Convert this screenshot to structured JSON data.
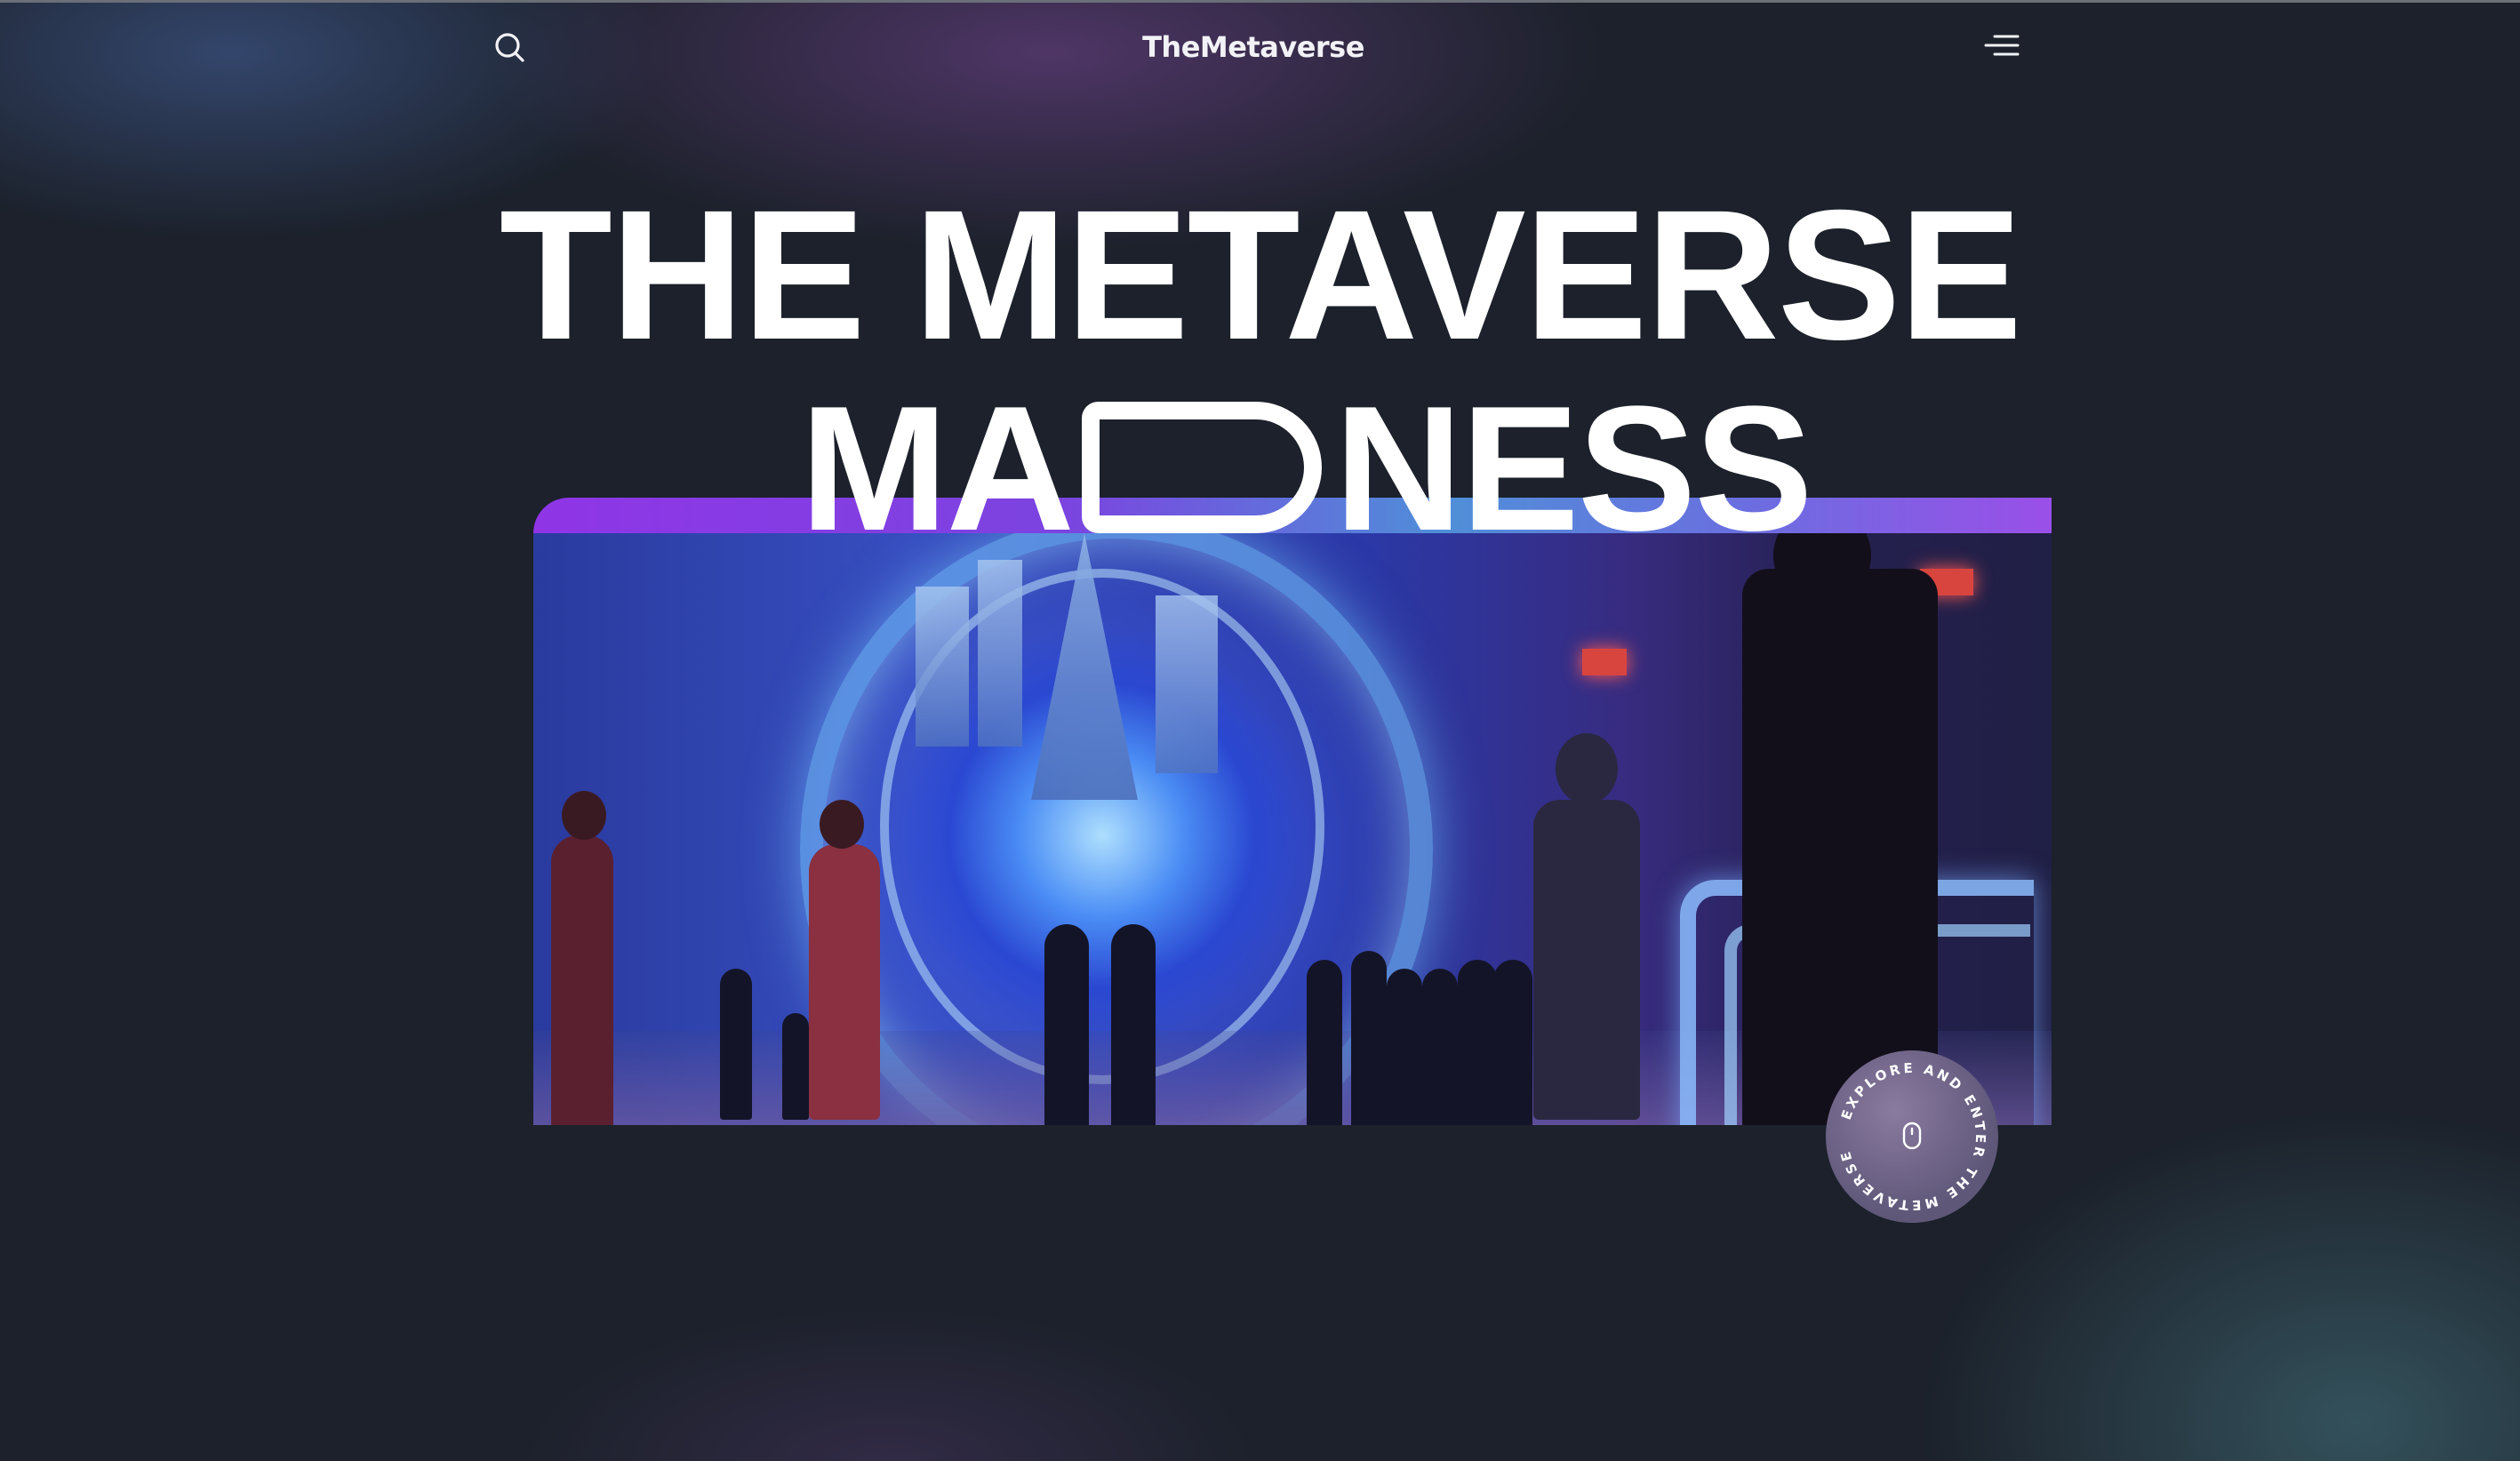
{
  "header": {
    "brand": "TheMetaverse",
    "search_icon": "search-icon",
    "menu_icon": "menu-icon"
  },
  "hero": {
    "headline_line1": "THE METAVERSE",
    "headline_line2_prefix": "MA",
    "headline_line2_suffix": "NESS",
    "image_alt": "people walking into a glowing metaverse portal",
    "accent_colors": [
      "#8f35e6",
      "#4f8fd8",
      "#9a4fe8"
    ]
  },
  "badge": {
    "circular_text": "EXPLORE AND ENTER THE METAVERSE",
    "icon": "mouse-icon"
  },
  "colors": {
    "background": "#1c212b",
    "text": "#ffffff"
  }
}
